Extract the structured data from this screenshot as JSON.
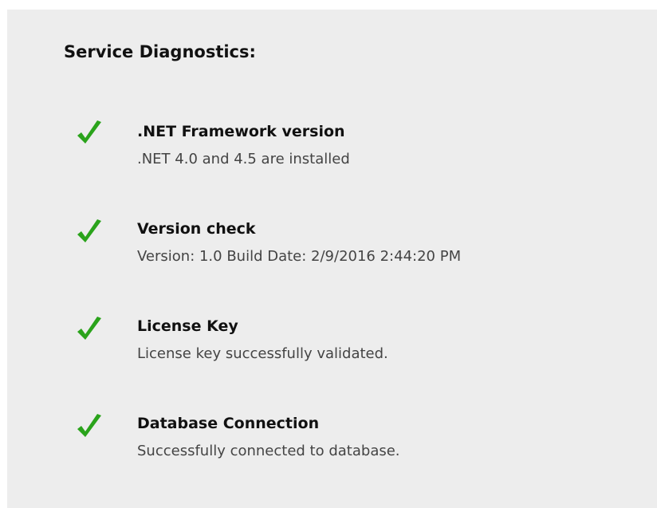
{
  "header": {
    "title": "Service Diagnostics:"
  },
  "colors": {
    "panel_background": "#ededed",
    "check_icon": "#2aa31b"
  },
  "items": [
    {
      "icon": "check-icon",
      "status": "success",
      "title": ".NET Framework version",
      "detail": ".NET 4.0 and 4.5 are installed"
    },
    {
      "icon": "check-icon",
      "status": "success",
      "title": "Version check",
      "detail": "Version: 1.0 Build Date: 2/9/2016 2:44:20 PM"
    },
    {
      "icon": "check-icon",
      "status": "success",
      "title": "License Key",
      "detail": "License key successfully validated."
    },
    {
      "icon": "check-icon",
      "status": "success",
      "title": "Database Connection",
      "detail": "Successfully connected to database."
    }
  ]
}
